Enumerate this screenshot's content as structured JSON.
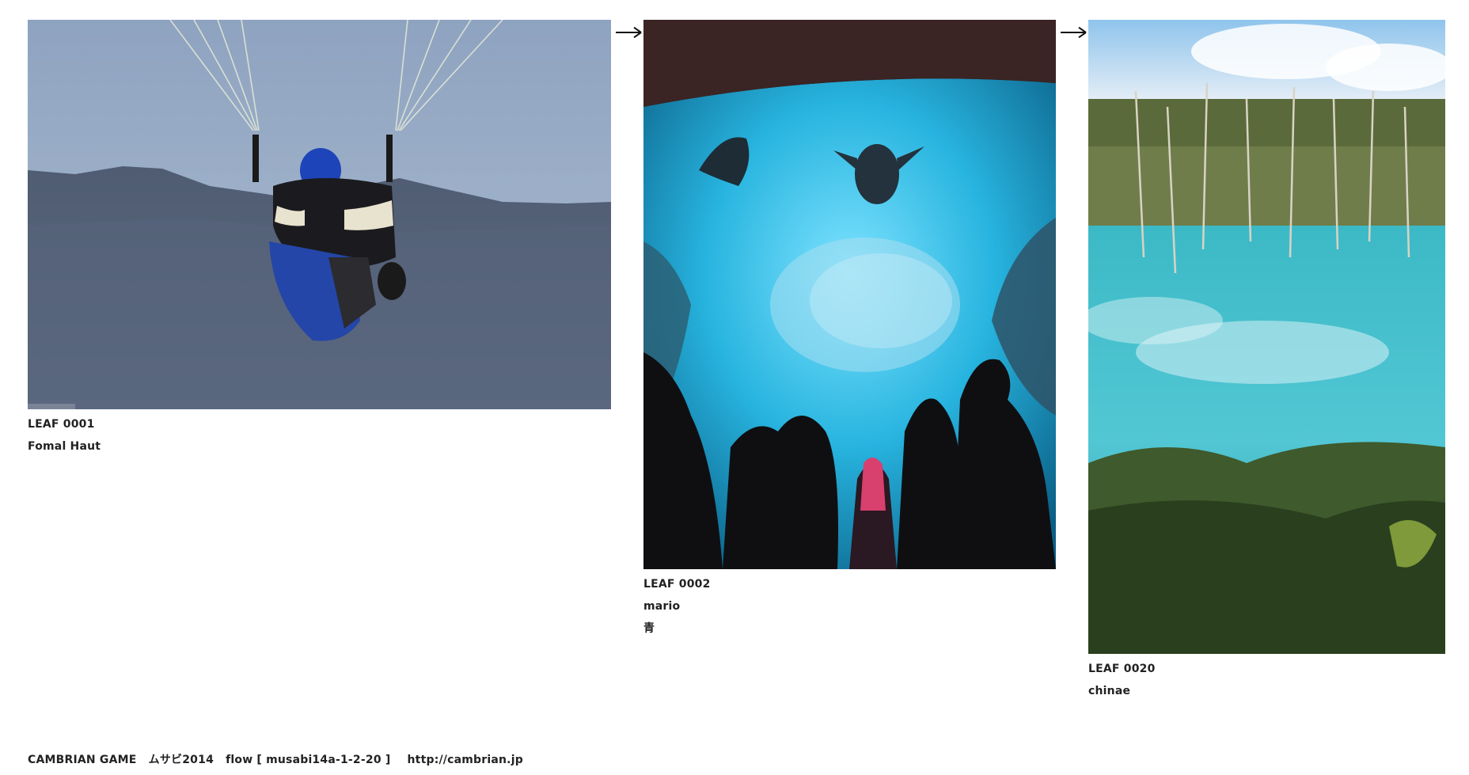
{
  "leaves": [
    {
      "id_label": "LEAF 0001",
      "author": "Fomal Haut",
      "note": "",
      "image_subject": "paraglider-photo"
    },
    {
      "id_label": "LEAF 0002",
      "author": "mario",
      "note": "青",
      "image_subject": "aquarium-photo"
    },
    {
      "id_label": "LEAF 0020",
      "author": "chinae",
      "note": "",
      "image_subject": "blue-pond-photo"
    }
  ],
  "arrows": [
    "right-arrow-icon",
    "right-arrow-icon"
  ],
  "footer": {
    "site": "CAMBRIAN GAME",
    "session": "ムサビ2014",
    "flow": "flow [ musabi14a-1-2-20 ]",
    "url": "http://cambrian.jp"
  },
  "colors": {
    "background": "#ffffff",
    "text": "#222222"
  }
}
